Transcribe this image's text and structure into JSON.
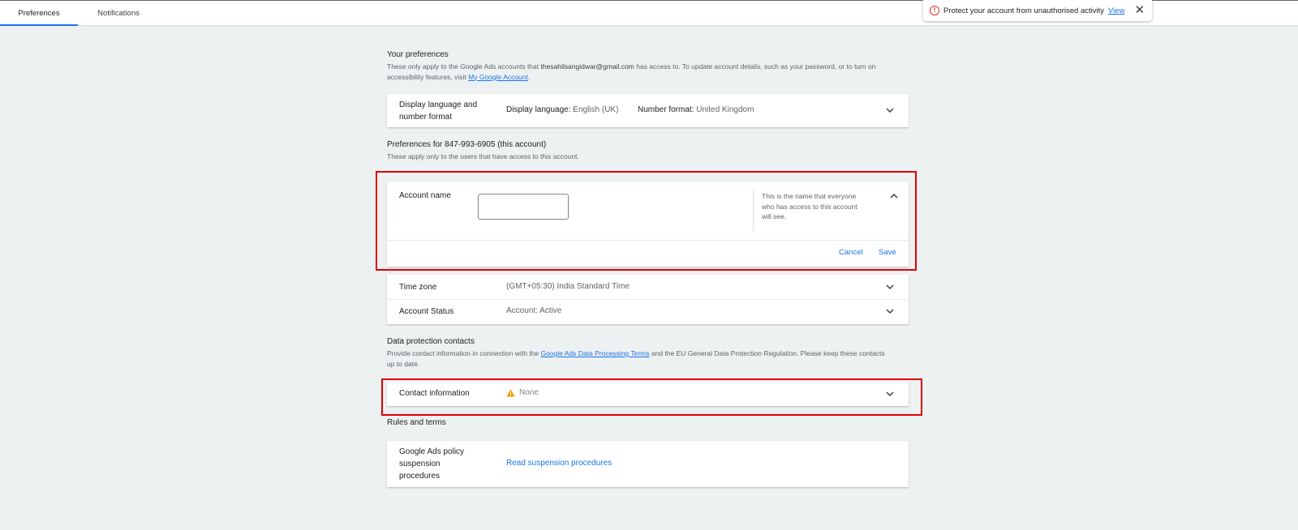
{
  "tabs": [
    {
      "label": "Preferences",
      "active": true
    },
    {
      "label": "Notifications",
      "active": false
    }
  ],
  "toast": {
    "message": "Protect your account from unauthorised activity",
    "link": "View",
    "icon": "error-icon",
    "close_icon": "close-icon"
  },
  "your_prefs": {
    "title": "Your preferences",
    "desc_pre": "These only apply to the Google Ads accounts that ",
    "email": "thesahilsangidwar@gmail.com",
    "desc_mid": " has access to. To update account details, such as your password, or to turn on accessibility features, visit ",
    "link": "My Google Account",
    "desc_end": "."
  },
  "display_lang": {
    "label_line1": "Display language and",
    "label_line2": "number format",
    "lang_key": "Display language:",
    "lang_val": "English (UK)",
    "num_key": "Number format:",
    "num_val": "United Kingdom"
  },
  "account_prefs": {
    "title": "Preferences for 847-993-6905 (this account)",
    "desc": "These apply only to the users that have access to this account."
  },
  "account_name": {
    "label": "Account name",
    "value": "",
    "help": "This is the name that everyone who has access to this account will see.",
    "cancel": "Cancel",
    "save": "Save"
  },
  "time_zone": {
    "label": "Time zone",
    "value": "(GMT+05:30) India Standard Time"
  },
  "account_status": {
    "label": "Account Status",
    "value": "Account: Active"
  },
  "data_protection": {
    "title": "Data protection contacts",
    "desc_pre": "Provide contact information in connection with the ",
    "link": "Google Ads Data Processing Terms",
    "desc_post": " and the EU General Data Protection Regulation. Please keep these contacts up to date."
  },
  "contact_info": {
    "label": "Contact information",
    "value": "None",
    "icon": "warning-icon"
  },
  "rules": {
    "title": "Rules and terms",
    "label_line1": "Google Ads policy",
    "label_line2": "suspension",
    "label_line3": "procedures",
    "link": "Read suspension procedures"
  },
  "colors": {
    "accent": "#1a73e8",
    "highlight": "#e00000",
    "warning": "#f29900",
    "error": "#d93025"
  }
}
